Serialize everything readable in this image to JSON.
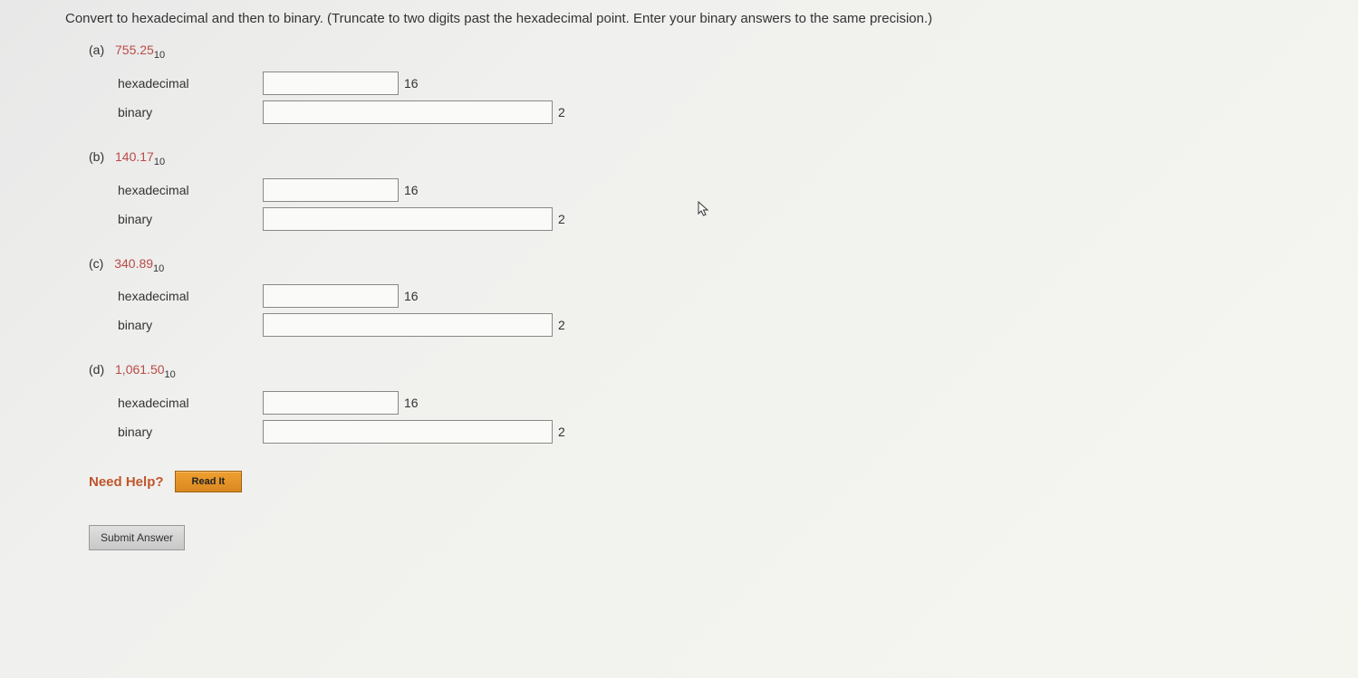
{
  "instruction": "Convert to hexadecimal and then to binary. (Truncate to two digits past the hexadecimal point. Enter your binary answers to the same precision.)",
  "labels": {
    "hex": "hexadecimal",
    "bin": "binary",
    "base16": "16",
    "base2": "2",
    "base10": "10"
  },
  "parts": {
    "a": {
      "label": "(a)",
      "value": "755.25"
    },
    "b": {
      "label": "(b)",
      "value": "140.17"
    },
    "c": {
      "label": "(c)",
      "value": "340.89"
    },
    "d": {
      "label": "(d)",
      "value": "1,061.50"
    }
  },
  "help": {
    "label": "Need Help?",
    "read": "Read It"
  },
  "submit": "Submit Answer"
}
